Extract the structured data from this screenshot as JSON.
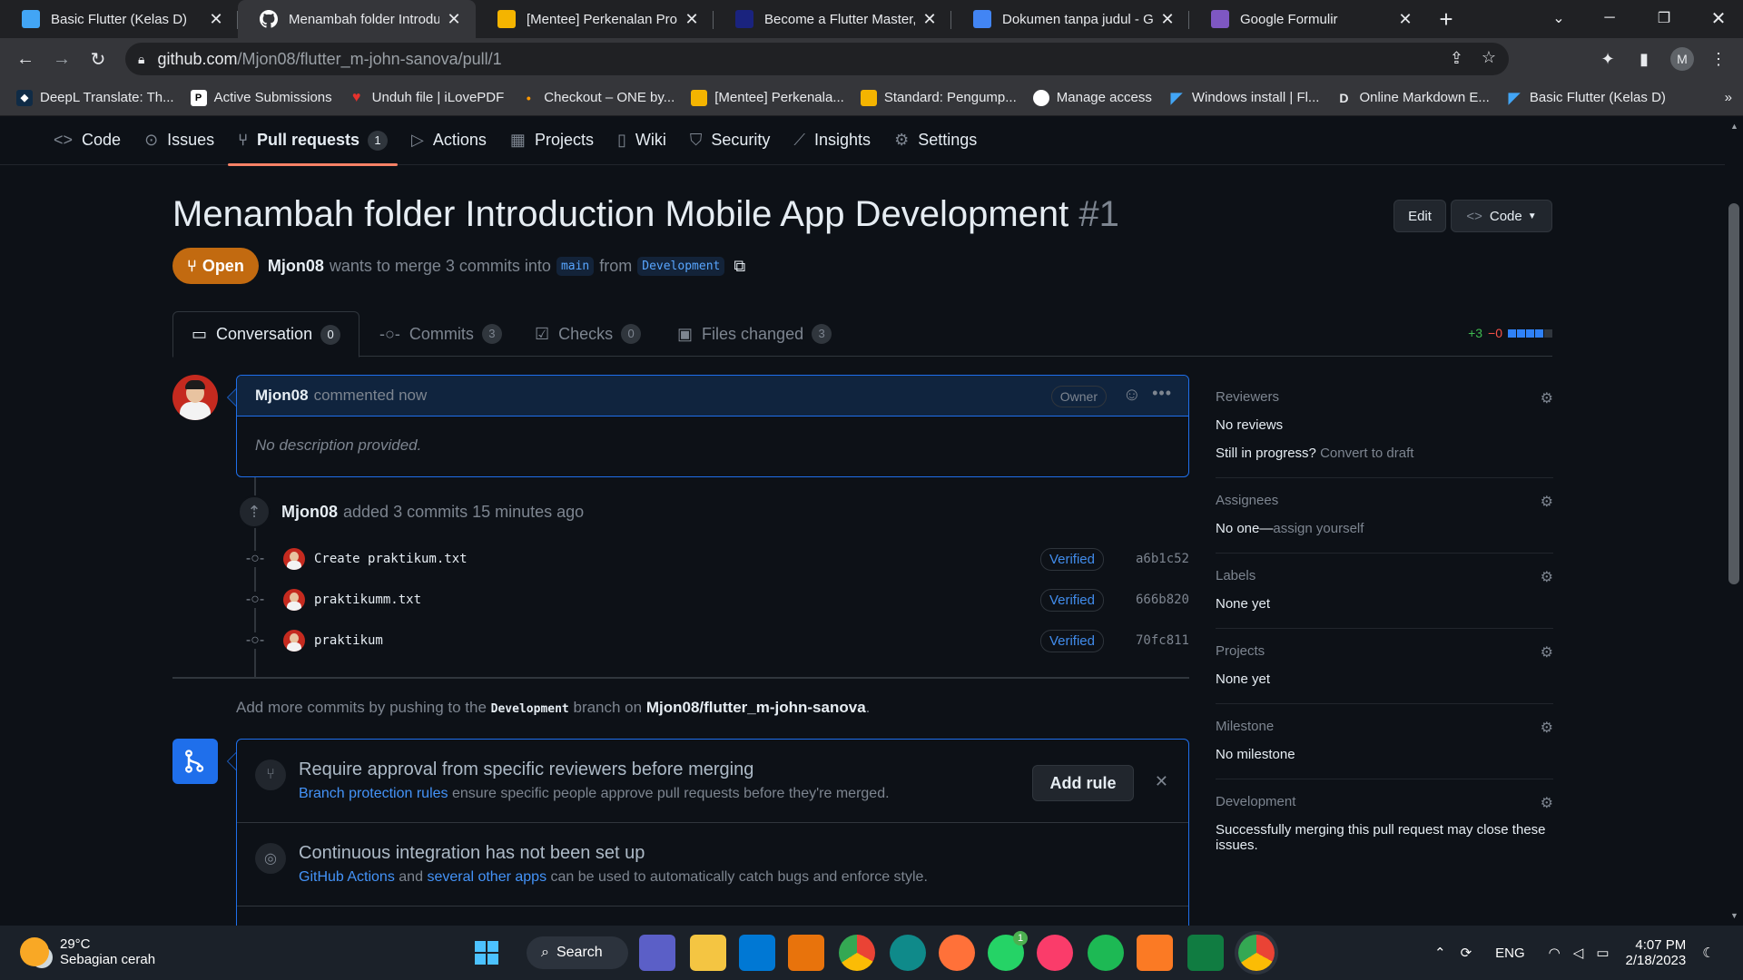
{
  "browser": {
    "tabs": [
      {
        "title": "Basic Flutter (Kelas D)",
        "fav_color": "#42a5f5",
        "active": false
      },
      {
        "title": "Menambah folder Introduction",
        "fav_color": "#ffffff",
        "active": true
      },
      {
        "title": "[Mentee] Perkenalan Progra",
        "fav_color": "#f4b400",
        "active": false
      },
      {
        "title": "Become a Flutter Master, Fr",
        "fav_color": "#1a237e",
        "active": false
      },
      {
        "title": "Dokumen tanpa judul - Goo",
        "fav_color": "#4285f4",
        "active": false
      },
      {
        "title": "Google Formulir",
        "fav_color": "#7e57c2",
        "active": false
      }
    ],
    "url_host": "github.com",
    "url_path": "/Mjon08/flutter_m-john-sanova/pull/1",
    "profile_initial": "M",
    "bookmarks": [
      {
        "label": "DeepL Translate: Th...",
        "color": "#0f2b46"
      },
      {
        "label": "Active Submissions",
        "color": "#ffffff"
      },
      {
        "label": "Unduh file | iLovePDF",
        "color": "#e5322d"
      },
      {
        "label": "Checkout – ONE by...",
        "color": "#ff9800"
      },
      {
        "label": "[Mentee] Perkenala...",
        "color": "#f4b400"
      },
      {
        "label": "Standard: Pengump...",
        "color": "#f4b400"
      },
      {
        "label": "Manage access",
        "color": "#ffffff"
      },
      {
        "label": "Windows install | Fl...",
        "color": "#42a5f5"
      },
      {
        "label": "Online Markdown E...",
        "color": "#35363a"
      },
      {
        "label": "Basic Flutter (Kelas D)",
        "color": "#42a5f5"
      }
    ],
    "bookmark_more": "»"
  },
  "repo_nav": [
    {
      "label": "Code",
      "icon": "code-icon"
    },
    {
      "label": "Issues",
      "icon": "issue-icon"
    },
    {
      "label": "Pull requests",
      "icon": "pull-request-icon",
      "count": "1",
      "selected": true
    },
    {
      "label": "Actions",
      "icon": "play-icon"
    },
    {
      "label": "Projects",
      "icon": "table-icon"
    },
    {
      "label": "Wiki",
      "icon": "book-icon"
    },
    {
      "label": "Security",
      "icon": "shield-icon"
    },
    {
      "label": "Insights",
      "icon": "graph-icon"
    },
    {
      "label": "Settings",
      "icon": "gear-icon"
    }
  ],
  "pr": {
    "title": "Menambah folder Introduction Mobile App Development",
    "number": "#1",
    "edit_label": "Edit",
    "code_label": "Code",
    "state": "Open",
    "author": "Mjon08",
    "merge_text": "wants to merge 3 commits into",
    "base_branch": "main",
    "from_text": "from",
    "head_branch": "Development"
  },
  "pr_tabs": [
    {
      "label": "Conversation",
      "count": "0"
    },
    {
      "label": "Commits",
      "count": "3"
    },
    {
      "label": "Checks",
      "count": "0"
    },
    {
      "label": "Files changed",
      "count": "3"
    }
  ],
  "diffstat": {
    "added": "+3",
    "removed": "−0"
  },
  "comment": {
    "author": "Mjon08",
    "action": "commented now",
    "role": "Owner",
    "body": "No description provided."
  },
  "commits_event": {
    "author": "Mjon08",
    "text": "added 3 commits 15 minutes ago"
  },
  "commits": [
    {
      "message": "Create praktikum.txt",
      "badge": "Verified",
      "sha": "a6b1c52"
    },
    {
      "message": "praktikumm.txt",
      "badge": "Verified",
      "sha": "666b820"
    },
    {
      "message": "praktikum",
      "badge": "Verified",
      "sha": "70fc811"
    }
  ],
  "add_more": {
    "pre": "Add more commits by pushing to the",
    "branch": "Development",
    "mid": "branch on",
    "repo": "Mjon08/flutter_m-john-sanova",
    "end": "."
  },
  "merge_box": {
    "rule_title": "Require approval from specific reviewers before merging",
    "rule_link": "Branch protection rules",
    "rule_desc": "ensure specific people approve pull requests before they're merged.",
    "add_rule": "Add rule",
    "ci_title": "Continuous integration has not been set up",
    "ci_link1": "GitHub Actions",
    "ci_and": "and",
    "ci_link2": "several other apps",
    "ci_desc": "can be used to automatically catch bugs and enforce style."
  },
  "sidebar": {
    "reviewers_title": "Reviewers",
    "reviewers_value": "No reviews",
    "progress_q": "Still in progress?",
    "progress_link": "Convert to draft",
    "assignees_title": "Assignees",
    "assignees_value": "No one—",
    "assignees_link": "assign yourself",
    "labels_title": "Labels",
    "labels_value": "None yet",
    "projects_title": "Projects",
    "projects_value": "None yet",
    "milestone_title": "Milestone",
    "milestone_value": "No milestone",
    "development_title": "Development",
    "development_value": "Successfully merging this pull request may close these issues."
  },
  "taskbar": {
    "temp": "29°C",
    "weather": "Sebagian cerah",
    "search": "Search",
    "lang": "ENG",
    "time": "4:07 PM",
    "date": "2/18/2023",
    "whatsapp_badge": "1"
  }
}
